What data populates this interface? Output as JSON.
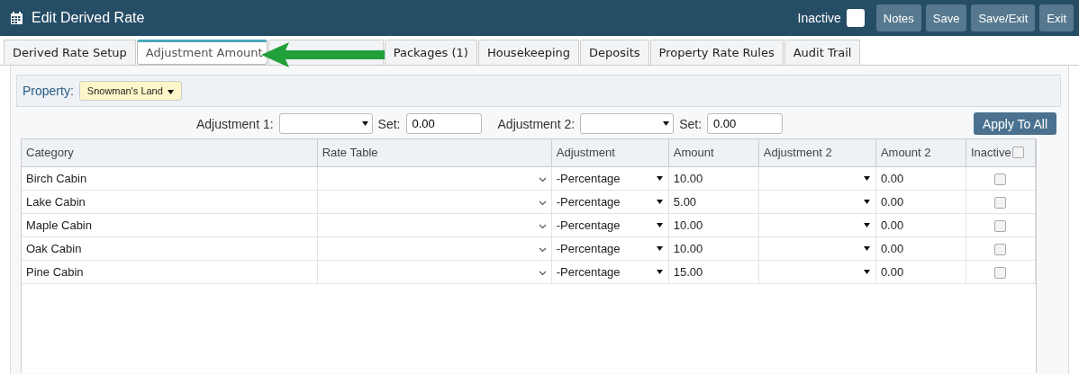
{
  "window": {
    "title": "Edit Derived Rate"
  },
  "header": {
    "inactive_label": "Inactive",
    "inactive_checked": false,
    "buttons": [
      "Notes",
      "Save",
      "Save/Exit",
      "Exit"
    ]
  },
  "tabs": [
    {
      "label": "Derived Rate Setup",
      "selected": false
    },
    {
      "label": "Adjustment Amount",
      "selected": true
    },
    {
      "selected": false
    },
    {
      "label": "Packages (1)",
      "selected": false
    },
    {
      "label": "Housekeeping",
      "selected": false
    },
    {
      "label": "Deposits",
      "selected": false
    },
    {
      "label": "Property Rate Rules",
      "selected": false
    },
    {
      "label": "Audit Trail",
      "selected": false
    }
  ],
  "property": {
    "label": "Property:",
    "value": "Snowman's Land"
  },
  "bulk": {
    "adjustment1_label": "Adjustment 1:",
    "set1_label": "Set:",
    "set1_value": "0.00",
    "adjustment2_label": "Adjustment 2:",
    "set2_label": "Set:",
    "set2_value": "0.00",
    "apply_button": "Apply To All"
  },
  "table": {
    "columns": [
      "Category",
      "Rate Table",
      "Adjustment",
      "Amount",
      "Adjustment 2",
      "Amount 2",
      "Inactive"
    ],
    "all_inactive_checked": false,
    "rows": [
      {
        "category": "Birch Cabin",
        "adjustment": "-Percentage",
        "amount": "10.00",
        "amount2": "0.00",
        "inactive": false
      },
      {
        "category": "Lake Cabin",
        "adjustment": "-Percentage",
        "amount": "5.00",
        "amount2": "0.00",
        "inactive": false
      },
      {
        "category": "Maple Cabin",
        "adjustment": "-Percentage",
        "amount": "10.00",
        "amount2": "0.00",
        "inactive": false
      },
      {
        "category": "Oak Cabin",
        "adjustment": "-Percentage",
        "amount": "10.00",
        "amount2": "0.00",
        "inactive": false
      },
      {
        "category": "Pine Cabin",
        "adjustment": "-Percentage",
        "amount": "15.00",
        "amount2": "0.00",
        "inactive": false
      }
    ]
  }
}
